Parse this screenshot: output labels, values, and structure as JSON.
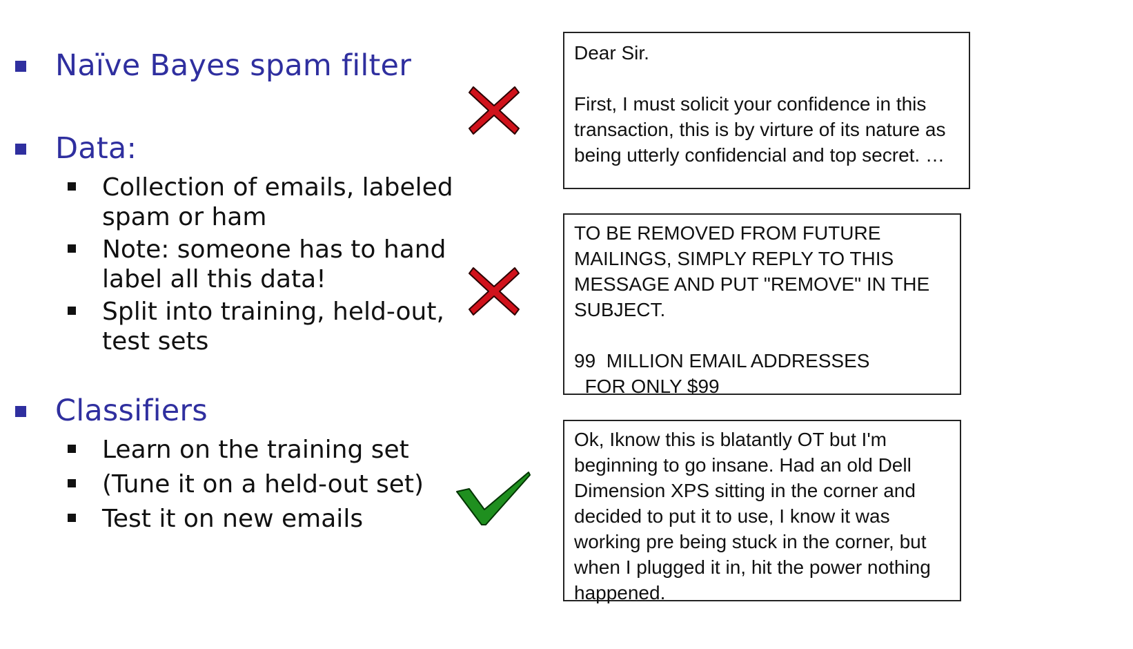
{
  "left": {
    "headings": [
      "Naïve Bayes spam filter",
      "Data:",
      "Classifiers"
    ],
    "data_items": [
      "Collection of emails, labeled spam or ham",
      "Note: someone has to hand label all this data!",
      "Split into training, held-out, test sets"
    ],
    "classifier_items": [
      "Learn on the training set",
      "(Tune it on a held-out set)",
      "Test it on new emails"
    ]
  },
  "emails": [
    {
      "label": "spam",
      "text": "Dear Sir.\n\nFirst, I must solicit your confidence in this transaction, this is by virture of its nature as being utterly confidencial and top secret. …"
    },
    {
      "label": "spam",
      "text": "TO BE REMOVED FROM FUTURE MAILINGS, SIMPLY REPLY TO THIS MESSAGE AND PUT \"REMOVE\" IN THE SUBJECT.\n\n99  MILLION EMAIL ADDRESSES\n  FOR ONLY $99"
    },
    {
      "label": "ham",
      "text": "Ok, Iknow this is blatantly OT but I'm beginning to go insane. Had an old Dell Dimension XPS sitting in the corner and decided to put it to use, I know it was working pre being stuck in the corner, but when I plugged it in, hit the power nothing happened."
    }
  ],
  "colors": {
    "heading": "#2f2f9f",
    "spam_mark": "#d0121b",
    "ham_mark": "#1f8f1f"
  },
  "icons": [
    "cross-icon",
    "cross-icon",
    "check-icon"
  ]
}
